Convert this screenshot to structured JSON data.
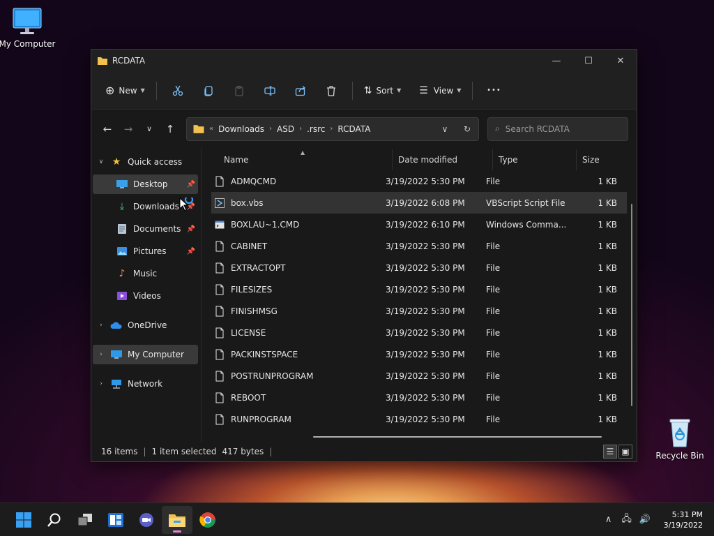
{
  "desktop": {
    "my_computer_label": "My Computer",
    "recycle_bin_label": "Recycle Bin"
  },
  "window": {
    "title": "RCDATA",
    "controls": {
      "minimize": "—",
      "maximize": "☐",
      "close": "✕"
    }
  },
  "toolbar": {
    "new_label": "New",
    "sort_label": "Sort",
    "view_label": "View",
    "more_label": "•••"
  },
  "address": {
    "overflow": "«",
    "crumbs": [
      "Downloads",
      "ASD",
      ".rsrc",
      "RCDATA"
    ]
  },
  "search": {
    "placeholder": "Search RCDATA"
  },
  "sidebar": {
    "quick_access": "Quick access",
    "items": [
      {
        "label": "Desktop",
        "icon": "desktop-icon",
        "pinned": true
      },
      {
        "label": "Downloads",
        "icon": "downloads-icon",
        "pinned": true
      },
      {
        "label": "Documents",
        "icon": "documents-icon",
        "pinned": true
      },
      {
        "label": "Pictures",
        "icon": "pictures-icon",
        "pinned": true
      },
      {
        "label": "Music",
        "icon": "music-icon",
        "pinned": false
      },
      {
        "label": "Videos",
        "icon": "videos-icon",
        "pinned": false
      }
    ],
    "onedrive": "OneDrive",
    "my_computer": "My Computer",
    "network": "Network"
  },
  "columns": {
    "name": "Name",
    "date": "Date modified",
    "type": "Type",
    "size": "Size"
  },
  "files": [
    {
      "name": "ADMQCMD",
      "date": "3/19/2022 5:30 PM",
      "type": "File",
      "size": "1 KB"
    },
    {
      "name": "box.vbs",
      "date": "3/19/2022 6:08 PM",
      "type": "VBScript Script File",
      "size": "1 KB"
    },
    {
      "name": "BOXLAU~1.CMD",
      "date": "3/19/2022 6:10 PM",
      "type": "Windows Comma...",
      "size": "1 KB"
    },
    {
      "name": "CABINET",
      "date": "3/19/2022 5:30 PM",
      "type": "File",
      "size": "1 KB"
    },
    {
      "name": "EXTRACTOPT",
      "date": "3/19/2022 5:30 PM",
      "type": "File",
      "size": "1 KB"
    },
    {
      "name": "FILESIZES",
      "date": "3/19/2022 5:30 PM",
      "type": "File",
      "size": "1 KB"
    },
    {
      "name": "FINISHMSG",
      "date": "3/19/2022 5:30 PM",
      "type": "File",
      "size": "1 KB"
    },
    {
      "name": "LICENSE",
      "date": "3/19/2022 5:30 PM",
      "type": "File",
      "size": "1 KB"
    },
    {
      "name": "PACKINSTSPACE",
      "date": "3/19/2022 5:30 PM",
      "type": "File",
      "size": "1 KB"
    },
    {
      "name": "POSTRUNPROGRAM",
      "date": "3/19/2022 5:30 PM",
      "type": "File",
      "size": "1 KB"
    },
    {
      "name": "REBOOT",
      "date": "3/19/2022 5:30 PM",
      "type": "File",
      "size": "1 KB"
    },
    {
      "name": "RUNPROGRAM",
      "date": "3/19/2022 5:30 PM",
      "type": "File",
      "size": "1 KB"
    }
  ],
  "status": {
    "items": "16 items",
    "selected": "1 item selected",
    "bytes": "417 bytes",
    "divider": "|"
  },
  "clock": {
    "time": "5:31 PM",
    "date": "3/19/2022"
  },
  "colors": {
    "accent": "#4aa3ff",
    "folder": "#f2c14e",
    "taskbar_indicator": "#e782d8"
  }
}
